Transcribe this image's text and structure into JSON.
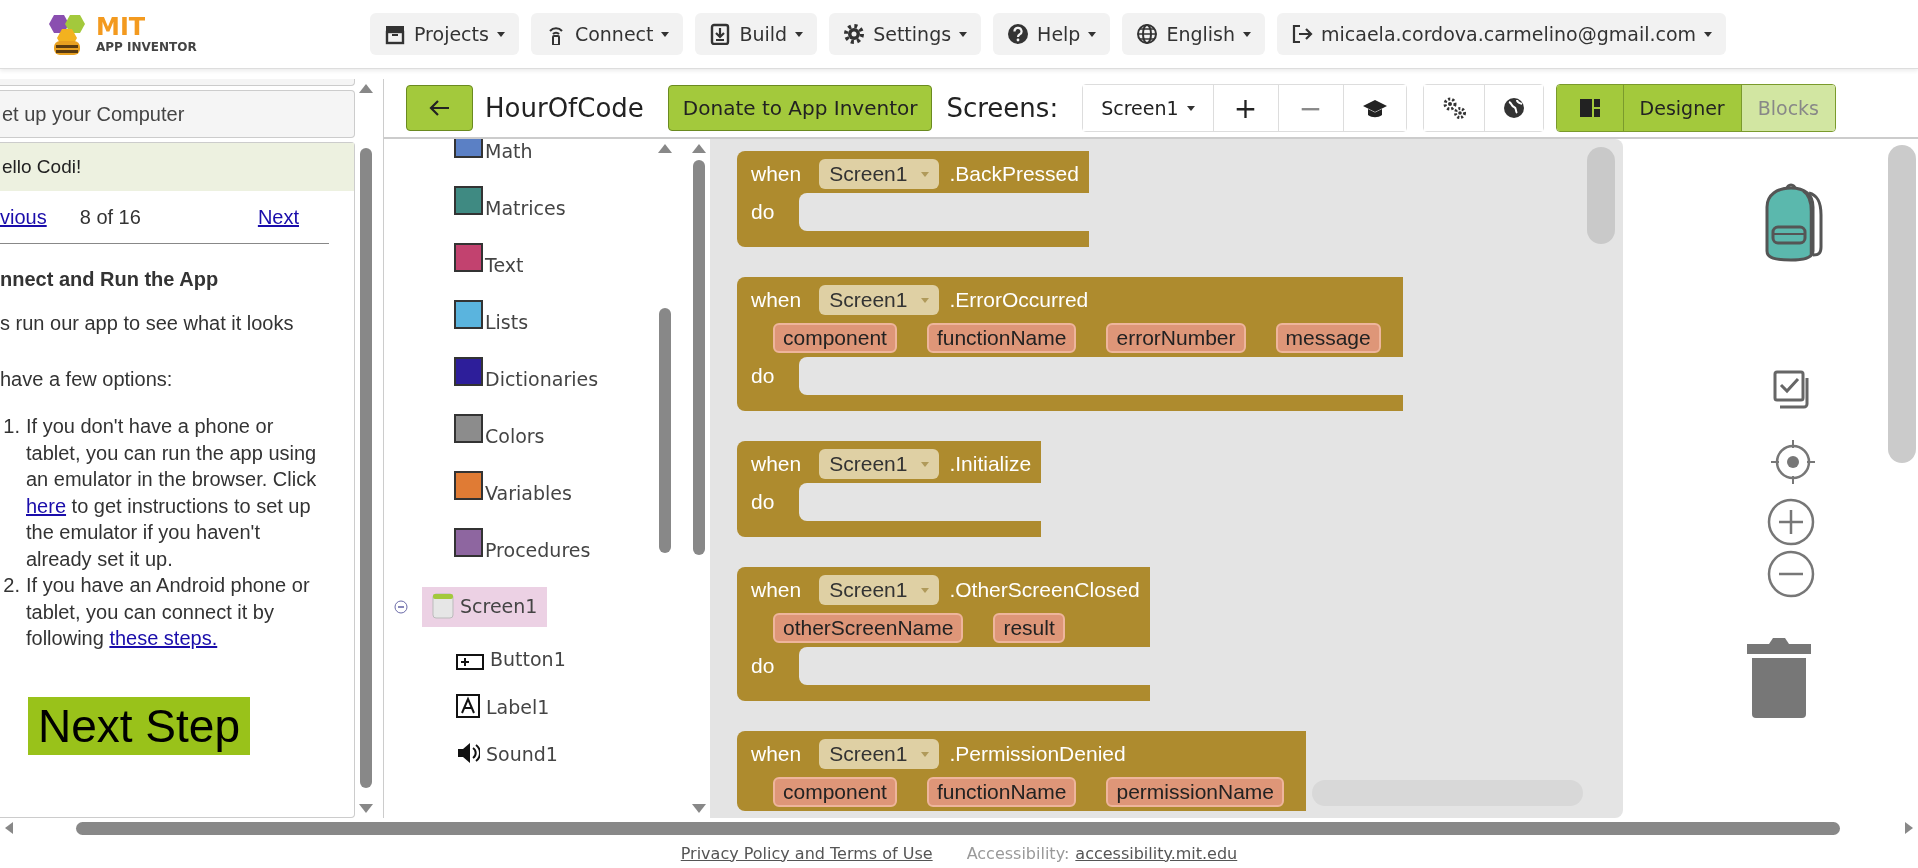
{
  "header": {
    "logo": {
      "title": "MIT",
      "subtitle": "APP INVENTOR"
    },
    "menus": [
      {
        "label": "Projects"
      },
      {
        "label": "Connect"
      },
      {
        "label": "Build"
      },
      {
        "label": "Settings"
      },
      {
        "label": "Help"
      },
      {
        "label": "English"
      },
      {
        "label": "micaela.cordova.carmelino@gmail.com"
      }
    ]
  },
  "tutorial": {
    "sections": [
      "et up your Computer"
    ],
    "title": "ello Codi!",
    "nav": {
      "previous": "vious",
      "position": "8 of 16",
      "next": "Next"
    },
    "heading": "nnect and Run the App",
    "paragraphs": [
      "s run our app to see what it looks",
      " have a few options:"
    ],
    "steps": [
      {
        "number": "1.",
        "parts": [
          {
            "text": "If you don't have a phone or tablet, you can run the app using an emulator in the browser. Click "
          },
          {
            "link": "here"
          },
          {
            "text": " to get instructions to set up the emulator if you haven't already set it up."
          }
        ]
      },
      {
        "number": "2.",
        "parts": [
          {
            "text": "If you have an Android phone or tablet, you can connect it by following "
          },
          {
            "link": "these steps."
          }
        ]
      }
    ],
    "next_button": "Next Step"
  },
  "toolbar": {
    "project": "HourOfCode",
    "donate": "Donate to App Inventor",
    "screens_label": "Screens:",
    "screen": "Screen1",
    "add": "+",
    "remove": "−",
    "views": [
      {
        "label": "Designer",
        "selected": false
      },
      {
        "label": "Blocks",
        "selected": true
      }
    ]
  },
  "tree": {
    "categories": [
      {
        "label": "Math",
        "color": "#5b80c5"
      },
      {
        "label": "Matrices",
        "color": "#3f8a82"
      },
      {
        "label": "Text",
        "color": "#c2426f"
      },
      {
        "label": "Lists",
        "color": "#5ab4de"
      },
      {
        "label": "Dictionaries",
        "color": "#2d1e9a"
      },
      {
        "label": "Colors",
        "color": "#8c8c8c"
      },
      {
        "label": "Variables",
        "color": "#e07b34"
      },
      {
        "label": "Procedures",
        "color": "#8e66a0"
      }
    ],
    "components": [
      {
        "label": "Screen1",
        "kind": "screen",
        "selected": true,
        "expanded": true,
        "children": [
          {
            "label": "Button1",
            "kind": "button",
            "selected": false
          },
          {
            "label": "Label1",
            "kind": "label",
            "selected": false
          },
          {
            "label": "Sound1",
            "kind": "sound",
            "selected": false
          }
        ]
      }
    ]
  },
  "workspace": {
    "blocks": [
      {
        "when": "when",
        "component": "Screen1",
        "event": ".BackPressed",
        "do": "do"
      },
      {
        "when": "when",
        "component": "Screen1",
        "event": ".ErrorOccurred",
        "params": [
          "component",
          "functionName",
          "errorNumber",
          "message"
        ],
        "do": "do"
      },
      {
        "when": "when",
        "component": "Screen1",
        "event": ".Initialize",
        "do": "do"
      },
      {
        "when": "when",
        "component": "Screen1",
        "event": ".OtherScreenClosed",
        "params": [
          "otherScreenName",
          "result"
        ],
        "do": "do"
      },
      {
        "when": "when",
        "component": "Screen1",
        "event": ".PermissionDenied",
        "params": [
          "component",
          "functionName",
          "permissionName"
        ]
      }
    ]
  },
  "footer": {
    "privacy": "Privacy Policy and Terms of Use",
    "accessibility_label": "Accessibility:",
    "accessibility_link": "accessibility.mit.edu"
  }
}
